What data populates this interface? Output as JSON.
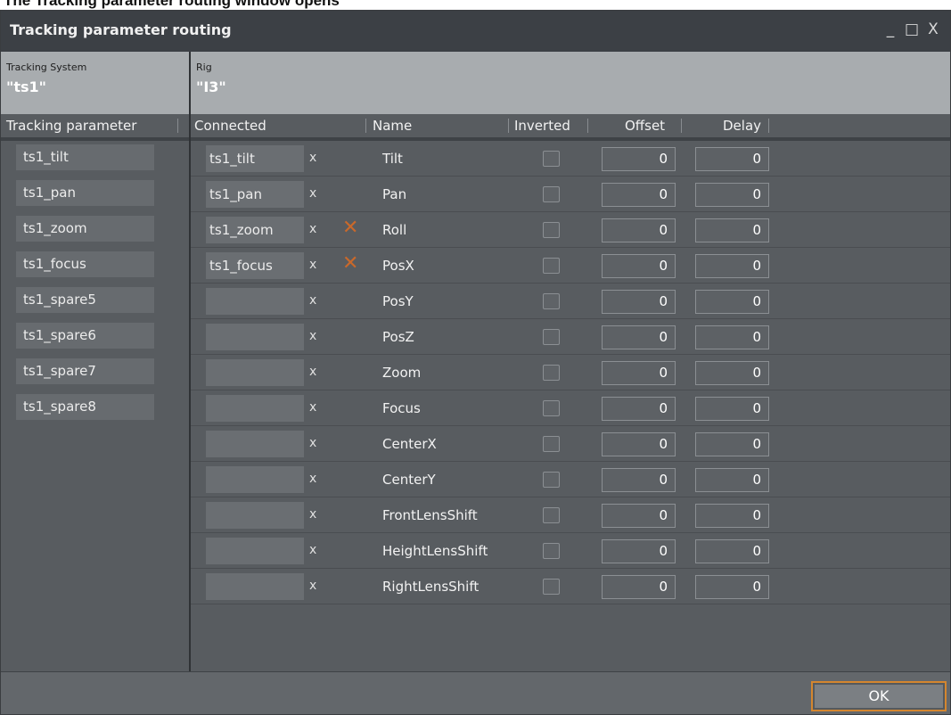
{
  "page_heading": "The Tracking parameter routing window opens",
  "window": {
    "title": "Tracking parameter routing",
    "controls": {
      "minimize": "_",
      "maximize": "□",
      "close": "X"
    }
  },
  "context": {
    "left_label": "Tracking System",
    "left_value": "\"ts1\"",
    "right_label": "Rig",
    "right_value": "\"I3\""
  },
  "headers": {
    "tracking_parameter": "Tracking parameter",
    "connected": "Connected",
    "name": "Name",
    "inverted": "Inverted",
    "offset": "Offset",
    "delay": "Delay"
  },
  "tracking_parameters": [
    "ts1_tilt",
    "ts1_pan",
    "ts1_zoom",
    "ts1_focus",
    "ts1_spare5",
    "ts1_spare6",
    "ts1_spare7",
    "ts1_spare8"
  ],
  "rows": [
    {
      "connected": "ts1_tilt",
      "x": "x",
      "warning": "",
      "name": "Tilt",
      "offset": "0",
      "delay": "0"
    },
    {
      "connected": "ts1_pan",
      "x": "x",
      "warning": "",
      "name": "Pan",
      "offset": "0",
      "delay": "0"
    },
    {
      "connected": "ts1_zoom",
      "x": "x",
      "warning": "✕",
      "name": "Roll",
      "offset": "0",
      "delay": "0"
    },
    {
      "connected": "ts1_focus",
      "x": "x",
      "warning": "✕",
      "name": "PosX",
      "offset": "0",
      "delay": "0"
    },
    {
      "connected": "",
      "x": "x",
      "warning": "",
      "name": "PosY",
      "offset": "0",
      "delay": "0"
    },
    {
      "connected": "",
      "x": "x",
      "warning": "",
      "name": "PosZ",
      "offset": "0",
      "delay": "0"
    },
    {
      "connected": "",
      "x": "x",
      "warning": "",
      "name": "Zoom",
      "offset": "0",
      "delay": "0"
    },
    {
      "connected": "",
      "x": "x",
      "warning": "",
      "name": "Focus",
      "offset": "0",
      "delay": "0"
    },
    {
      "connected": "",
      "x": "x",
      "warning": "",
      "name": "CenterX",
      "offset": "0",
      "delay": "0"
    },
    {
      "connected": "",
      "x": "x",
      "warning": "",
      "name": "CenterY",
      "offset": "0",
      "delay": "0"
    },
    {
      "connected": "",
      "x": "x",
      "warning": "",
      "name": "FrontLensShift",
      "offset": "0",
      "delay": "0"
    },
    {
      "connected": "",
      "x": "x",
      "warning": "",
      "name": "HeightLensShift",
      "offset": "0",
      "delay": "0"
    },
    {
      "connected": "",
      "x": "x",
      "warning": "",
      "name": "RightLensShift",
      "offset": "0",
      "delay": "0"
    }
  ],
  "footer": {
    "ok_label": "OK"
  },
  "colors": {
    "accent": "#d4862f",
    "warning": "#c9692b"
  }
}
